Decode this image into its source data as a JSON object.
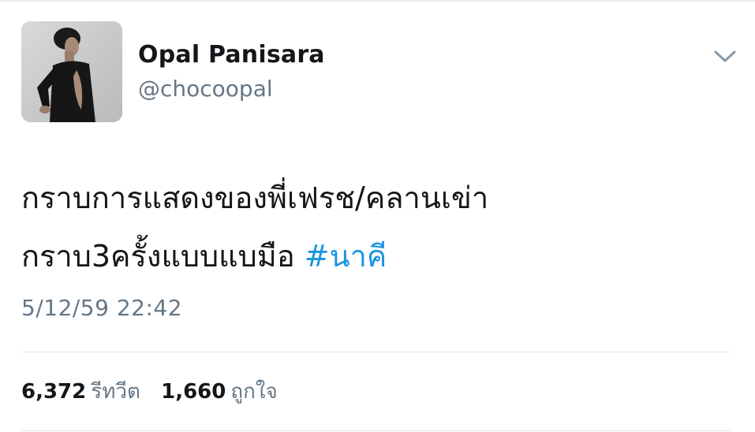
{
  "author": {
    "display_name": "Opal Panisara",
    "handle": "@chocoopal"
  },
  "tweet": {
    "text_line1": "กราบการแสดงของพี่เฟรช/คลานเข่า",
    "text_line2": "กราบ3ครั้งแบบแบมือ",
    "hashtag": "#นาคี",
    "timestamp": "5/12/59 22:42"
  },
  "stats": {
    "retweets_count": "6,372",
    "retweets_label": "รีทวีต",
    "likes_count": "1,660",
    "likes_label": "ถูกใจ"
  },
  "icons": {
    "menu": "chevron-down-icon"
  },
  "colors": {
    "hashtag": "#1b95e0",
    "secondary_text": "#657786",
    "primary_text": "#14171a"
  }
}
